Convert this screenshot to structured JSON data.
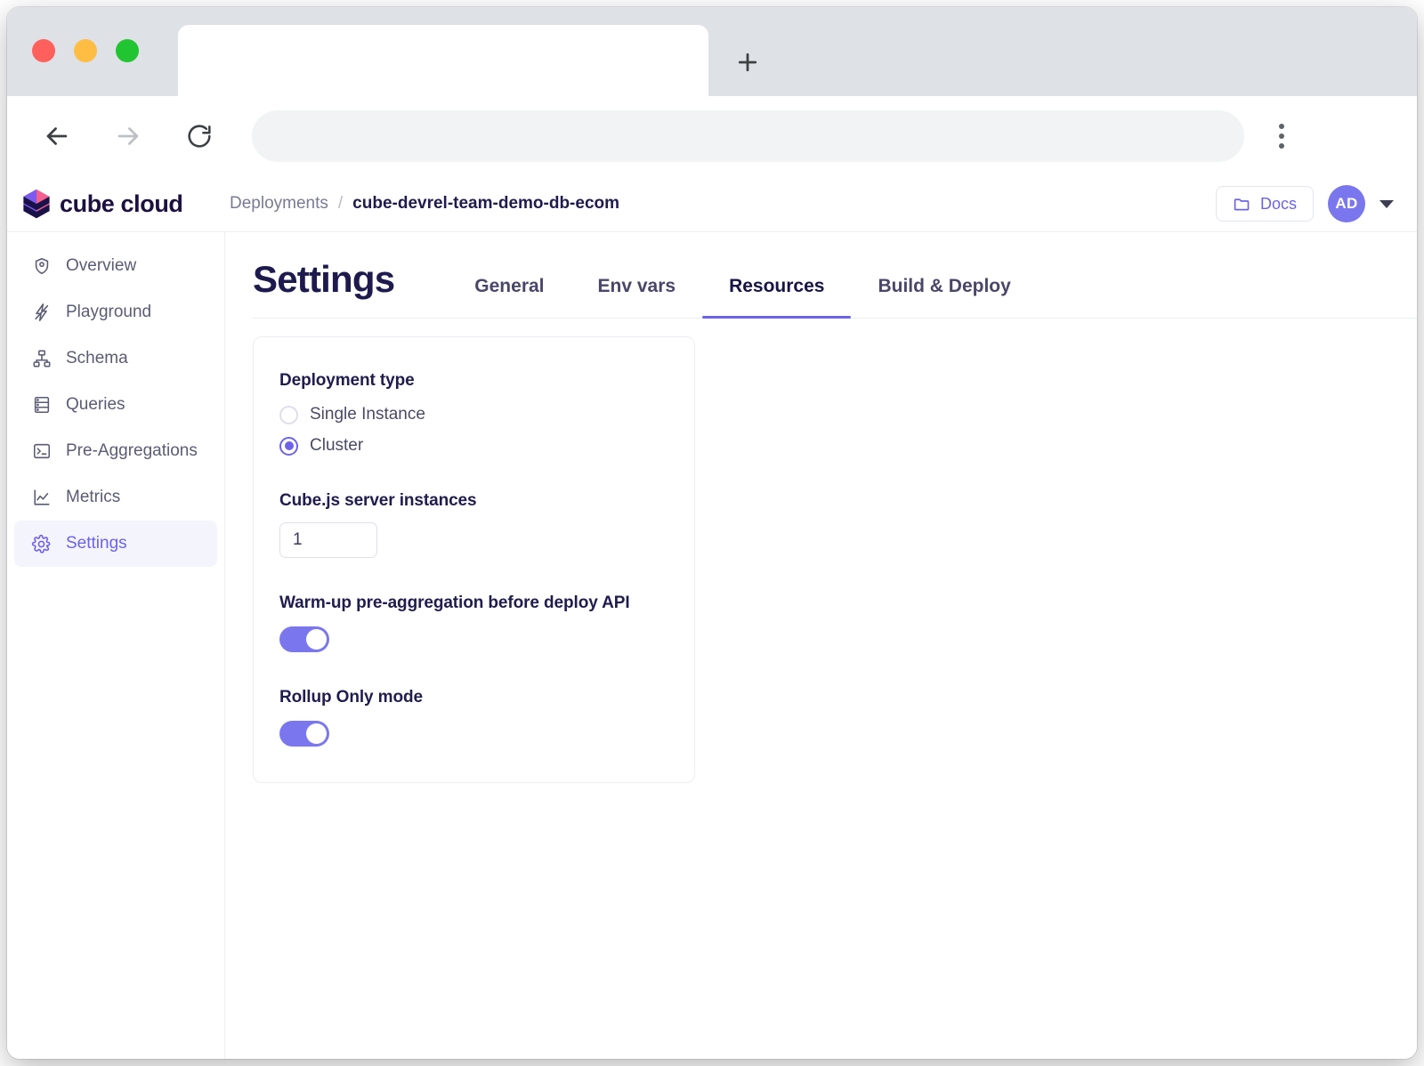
{
  "browser": {
    "traffic_lights": [
      "close",
      "minimize",
      "maximize"
    ],
    "tab_title": "",
    "new_tab_label": "+",
    "back_label": "Back",
    "forward_label": "Forward",
    "reload_label": "Reload",
    "address_value": "",
    "address_placeholder": "",
    "menu_label": "Customize and control"
  },
  "header": {
    "brand": "cube cloud",
    "breadcrumb": {
      "root": "Deployments",
      "separator": "/",
      "current": "cube-devrel-team-demo-db-ecom"
    },
    "docs_label": "Docs",
    "avatar_initials": "AD"
  },
  "sidebar": {
    "items": [
      {
        "label": "Overview",
        "icon": "shield-icon",
        "active": false
      },
      {
        "label": "Playground",
        "icon": "bolt-icon",
        "active": false
      },
      {
        "label": "Schema",
        "icon": "sitemap-icon",
        "active": false
      },
      {
        "label": "Queries",
        "icon": "database-icon",
        "active": false
      },
      {
        "label": "Pre-Aggregations",
        "icon": "terminal-icon",
        "active": false
      },
      {
        "label": "Metrics",
        "icon": "chart-icon",
        "active": false
      },
      {
        "label": "Settings",
        "icon": "gear-icon",
        "active": true
      }
    ]
  },
  "page": {
    "title": "Settings",
    "tabs": [
      {
        "label": "General",
        "active": false
      },
      {
        "label": "Env vars",
        "active": false
      },
      {
        "label": "Resources",
        "active": true
      },
      {
        "label": "Build & Deploy",
        "active": false
      }
    ]
  },
  "settings_card": {
    "deployment_type": {
      "label": "Deployment type",
      "options": [
        {
          "label": "Single Instance",
          "selected": false
        },
        {
          "label": "Cluster",
          "selected": true
        }
      ]
    },
    "server_instances": {
      "label": "Cube.js server instances",
      "value": "1"
    },
    "warmup": {
      "label": "Warm-up pre-aggregation before deploy API",
      "enabled": true
    },
    "rollup_only": {
      "label": "Rollup Only mode",
      "enabled": true
    }
  },
  "colors": {
    "accent": "#6c63e8",
    "toggle_on": "#7a77ee",
    "title": "#1e1a4e",
    "muted": "#7a7a93"
  }
}
